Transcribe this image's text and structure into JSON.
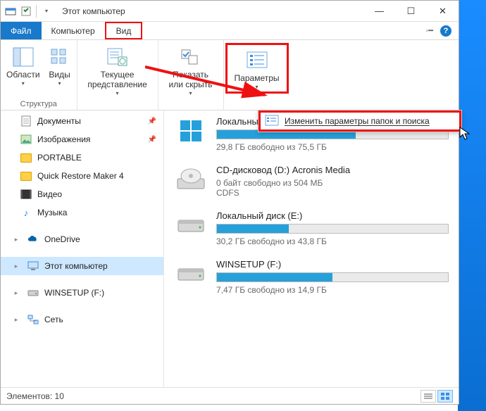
{
  "titlebar": {
    "title": "Этот компьютер"
  },
  "win": {
    "min": "—",
    "max": "☐",
    "close": "✕"
  },
  "tabs": {
    "file": "Файл",
    "computer": "Компьютер",
    "view": "Вид"
  },
  "ribbon": {
    "panes": {
      "label": "Области",
      "group": "Структура"
    },
    "layout": {
      "label": "Виды"
    },
    "current": {
      "label": "Текущее\nпредставление"
    },
    "showhide": {
      "label": "Показать\nили скрыть"
    },
    "options": {
      "label": "Параметры"
    }
  },
  "panel": {
    "text": "Изменить параметры папок и поиска"
  },
  "nav": {
    "documents": "Документы",
    "pictures": "Изображения",
    "portable": "PORTABLE",
    "qrm": "Quick Restore Maker 4",
    "video": "Видео",
    "music": "Музыка",
    "onedrive": "OneDrive",
    "thispc": "Этот компьютер",
    "winsetup": "WINSETUP (F:)",
    "network": "Сеть"
  },
  "drives": [
    {
      "name": "Локальный диск (C:)",
      "sub": "29,8 ГБ свободно из 75,5 ГБ",
      "fill": 60,
      "extra": ""
    },
    {
      "name": "CD-дисковод (D:) Acronis Media",
      "sub": "0 байт свободно из 504 МБ",
      "fill": 0,
      "extra": "CDFS"
    },
    {
      "name": "Локальный диск (E:)",
      "sub": "30,2 ГБ свободно из 43,8 ГБ",
      "fill": 31,
      "extra": ""
    },
    {
      "name": "WINSETUP (F:)",
      "sub": "7,47 ГБ свободно из 14,9 ГБ",
      "fill": 50,
      "extra": ""
    }
  ],
  "status": {
    "label": "Элементов:",
    "count": "10"
  }
}
